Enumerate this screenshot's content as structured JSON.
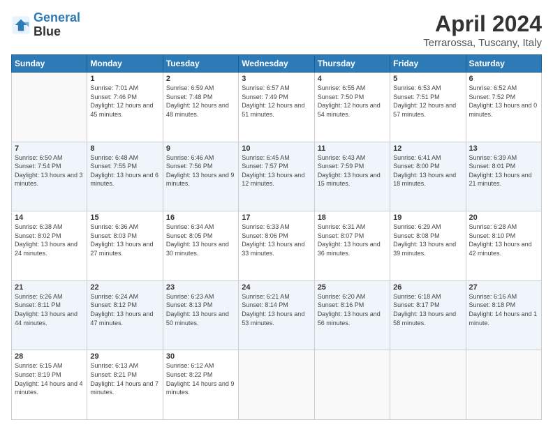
{
  "logo": {
    "line1": "General",
    "line2": "Blue"
  },
  "title": "April 2024",
  "subtitle": "Terrarossa, Tuscany, Italy",
  "weekdays": [
    "Sunday",
    "Monday",
    "Tuesday",
    "Wednesday",
    "Thursday",
    "Friday",
    "Saturday"
  ],
  "weeks": [
    [
      {
        "day": "",
        "sunrise": "",
        "sunset": "",
        "daylight": ""
      },
      {
        "day": "1",
        "sunrise": "Sunrise: 7:01 AM",
        "sunset": "Sunset: 7:46 PM",
        "daylight": "Daylight: 12 hours and 45 minutes."
      },
      {
        "day": "2",
        "sunrise": "Sunrise: 6:59 AM",
        "sunset": "Sunset: 7:48 PM",
        "daylight": "Daylight: 12 hours and 48 minutes."
      },
      {
        "day": "3",
        "sunrise": "Sunrise: 6:57 AM",
        "sunset": "Sunset: 7:49 PM",
        "daylight": "Daylight: 12 hours and 51 minutes."
      },
      {
        "day": "4",
        "sunrise": "Sunrise: 6:55 AM",
        "sunset": "Sunset: 7:50 PM",
        "daylight": "Daylight: 12 hours and 54 minutes."
      },
      {
        "day": "5",
        "sunrise": "Sunrise: 6:53 AM",
        "sunset": "Sunset: 7:51 PM",
        "daylight": "Daylight: 12 hours and 57 minutes."
      },
      {
        "day": "6",
        "sunrise": "Sunrise: 6:52 AM",
        "sunset": "Sunset: 7:52 PM",
        "daylight": "Daylight: 13 hours and 0 minutes."
      }
    ],
    [
      {
        "day": "7",
        "sunrise": "Sunrise: 6:50 AM",
        "sunset": "Sunset: 7:54 PM",
        "daylight": "Daylight: 13 hours and 3 minutes."
      },
      {
        "day": "8",
        "sunrise": "Sunrise: 6:48 AM",
        "sunset": "Sunset: 7:55 PM",
        "daylight": "Daylight: 13 hours and 6 minutes."
      },
      {
        "day": "9",
        "sunrise": "Sunrise: 6:46 AM",
        "sunset": "Sunset: 7:56 PM",
        "daylight": "Daylight: 13 hours and 9 minutes."
      },
      {
        "day": "10",
        "sunrise": "Sunrise: 6:45 AM",
        "sunset": "Sunset: 7:57 PM",
        "daylight": "Daylight: 13 hours and 12 minutes."
      },
      {
        "day": "11",
        "sunrise": "Sunrise: 6:43 AM",
        "sunset": "Sunset: 7:59 PM",
        "daylight": "Daylight: 13 hours and 15 minutes."
      },
      {
        "day": "12",
        "sunrise": "Sunrise: 6:41 AM",
        "sunset": "Sunset: 8:00 PM",
        "daylight": "Daylight: 13 hours and 18 minutes."
      },
      {
        "day": "13",
        "sunrise": "Sunrise: 6:39 AM",
        "sunset": "Sunset: 8:01 PM",
        "daylight": "Daylight: 13 hours and 21 minutes."
      }
    ],
    [
      {
        "day": "14",
        "sunrise": "Sunrise: 6:38 AM",
        "sunset": "Sunset: 8:02 PM",
        "daylight": "Daylight: 13 hours and 24 minutes."
      },
      {
        "day": "15",
        "sunrise": "Sunrise: 6:36 AM",
        "sunset": "Sunset: 8:03 PM",
        "daylight": "Daylight: 13 hours and 27 minutes."
      },
      {
        "day": "16",
        "sunrise": "Sunrise: 6:34 AM",
        "sunset": "Sunset: 8:05 PM",
        "daylight": "Daylight: 13 hours and 30 minutes."
      },
      {
        "day": "17",
        "sunrise": "Sunrise: 6:33 AM",
        "sunset": "Sunset: 8:06 PM",
        "daylight": "Daylight: 13 hours and 33 minutes."
      },
      {
        "day": "18",
        "sunrise": "Sunrise: 6:31 AM",
        "sunset": "Sunset: 8:07 PM",
        "daylight": "Daylight: 13 hours and 36 minutes."
      },
      {
        "day": "19",
        "sunrise": "Sunrise: 6:29 AM",
        "sunset": "Sunset: 8:08 PM",
        "daylight": "Daylight: 13 hours and 39 minutes."
      },
      {
        "day": "20",
        "sunrise": "Sunrise: 6:28 AM",
        "sunset": "Sunset: 8:10 PM",
        "daylight": "Daylight: 13 hours and 42 minutes."
      }
    ],
    [
      {
        "day": "21",
        "sunrise": "Sunrise: 6:26 AM",
        "sunset": "Sunset: 8:11 PM",
        "daylight": "Daylight: 13 hours and 44 minutes."
      },
      {
        "day": "22",
        "sunrise": "Sunrise: 6:24 AM",
        "sunset": "Sunset: 8:12 PM",
        "daylight": "Daylight: 13 hours and 47 minutes."
      },
      {
        "day": "23",
        "sunrise": "Sunrise: 6:23 AM",
        "sunset": "Sunset: 8:13 PM",
        "daylight": "Daylight: 13 hours and 50 minutes."
      },
      {
        "day": "24",
        "sunrise": "Sunrise: 6:21 AM",
        "sunset": "Sunset: 8:14 PM",
        "daylight": "Daylight: 13 hours and 53 minutes."
      },
      {
        "day": "25",
        "sunrise": "Sunrise: 6:20 AM",
        "sunset": "Sunset: 8:16 PM",
        "daylight": "Daylight: 13 hours and 56 minutes."
      },
      {
        "day": "26",
        "sunrise": "Sunrise: 6:18 AM",
        "sunset": "Sunset: 8:17 PM",
        "daylight": "Daylight: 13 hours and 58 minutes."
      },
      {
        "day": "27",
        "sunrise": "Sunrise: 6:16 AM",
        "sunset": "Sunset: 8:18 PM",
        "daylight": "Daylight: 14 hours and 1 minute."
      }
    ],
    [
      {
        "day": "28",
        "sunrise": "Sunrise: 6:15 AM",
        "sunset": "Sunset: 8:19 PM",
        "daylight": "Daylight: 14 hours and 4 minutes."
      },
      {
        "day": "29",
        "sunrise": "Sunrise: 6:13 AM",
        "sunset": "Sunset: 8:21 PM",
        "daylight": "Daylight: 14 hours and 7 minutes."
      },
      {
        "day": "30",
        "sunrise": "Sunrise: 6:12 AM",
        "sunset": "Sunset: 8:22 PM",
        "daylight": "Daylight: 14 hours and 9 minutes."
      },
      {
        "day": "",
        "sunrise": "",
        "sunset": "",
        "daylight": ""
      },
      {
        "day": "",
        "sunrise": "",
        "sunset": "",
        "daylight": ""
      },
      {
        "day": "",
        "sunrise": "",
        "sunset": "",
        "daylight": ""
      },
      {
        "day": "",
        "sunrise": "",
        "sunset": "",
        "daylight": ""
      }
    ]
  ],
  "colors": {
    "header_bg": "#2c7bb6",
    "header_text": "#ffffff",
    "accent": "#2c7bb6"
  }
}
